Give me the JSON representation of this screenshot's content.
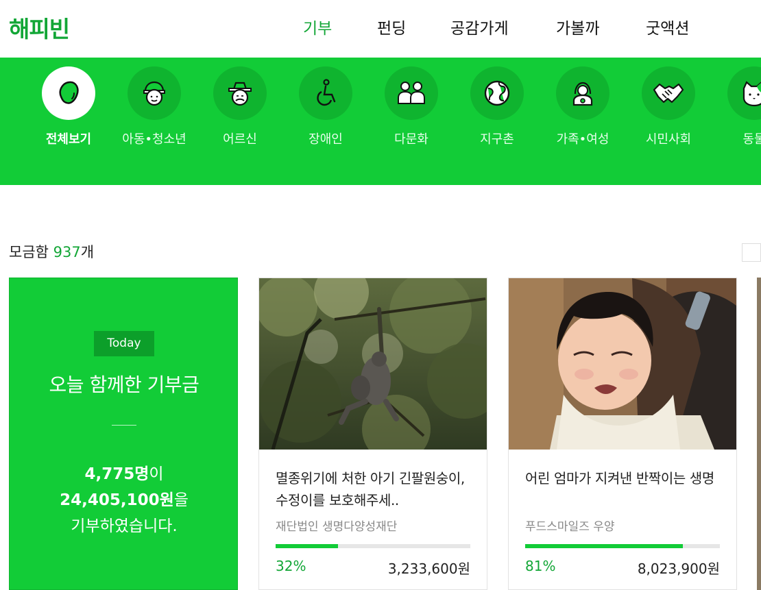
{
  "header": {
    "logo": "해피빈",
    "nav": [
      {
        "label": "기부",
        "active": true
      },
      {
        "label": "펀딩",
        "active": false
      },
      {
        "label": "공감가게",
        "active": false
      },
      {
        "label": "가볼까",
        "active": false
      },
      {
        "label": "굿액션",
        "active": false
      }
    ]
  },
  "categories": [
    {
      "label": "전체보기",
      "icon": "bean-icon",
      "active": true
    },
    {
      "label": "아동•청소년",
      "icon": "child-icon",
      "active": false
    },
    {
      "label": "어르신",
      "icon": "elder-icon",
      "active": false
    },
    {
      "label": "장애인",
      "icon": "wheelchair-icon",
      "active": false
    },
    {
      "label": "다문화",
      "icon": "people-icon",
      "active": false
    },
    {
      "label": "지구촌",
      "icon": "globe-icon",
      "active": false
    },
    {
      "label": "가족•여성",
      "icon": "family-icon",
      "active": false
    },
    {
      "label": "시민사회",
      "icon": "handshake-icon",
      "active": false
    },
    {
      "label": "동물",
      "icon": "animal-icon",
      "active": false
    }
  ],
  "listing": {
    "count_label": "모금함 ",
    "count": "937",
    "count_suffix": "개"
  },
  "today": {
    "badge": "Today",
    "title": "오늘 함께한 기부금",
    "people": "4,775명",
    "people_suffix": "이",
    "amount": "24,405,100원",
    "amount_suffix": "을",
    "closing": "기부하였습니다."
  },
  "cards": [
    {
      "title": "멸종위기에 처한 아기 긴팔원숭이, 수정이를 보호해주세..",
      "org": "재단법인 생명다양성재단",
      "percent": "32%",
      "progress": 0.32,
      "amount": "3,233,600원"
    },
    {
      "title": "어린 엄마가 지켜낸 반짝이는 생명",
      "org": "푸드스마일즈 우양",
      "percent": "81%",
      "progress": 0.81,
      "amount": "8,023,900원"
    }
  ],
  "colors": {
    "brand_green": "#12cc37",
    "brand_text_green": "#12a636"
  }
}
